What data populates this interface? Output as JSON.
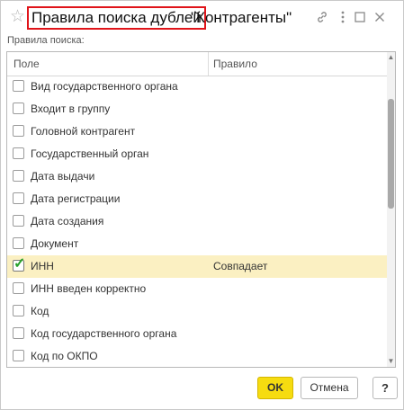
{
  "window": {
    "title_highlight": "Правила поиска дублей",
    "title_rest": "\"Контрагенты\""
  },
  "icons": {
    "favorite": "star-icon",
    "link": "link-icon",
    "more": "more-vertical-icon",
    "maximize": "maximize-icon",
    "close": "close-icon"
  },
  "search": {
    "label": "Правила поиска:"
  },
  "grid": {
    "headers": {
      "field": "Поле",
      "rule": "Правило"
    },
    "rows": [
      {
        "field": "Вид государственного органа",
        "rule": "",
        "checked": false
      },
      {
        "field": "Входит в группу",
        "rule": "",
        "checked": false
      },
      {
        "field": "Головной контрагент",
        "rule": "",
        "checked": false
      },
      {
        "field": "Государственный орган",
        "rule": "",
        "checked": false
      },
      {
        "field": "Дата выдачи",
        "rule": "",
        "checked": false
      },
      {
        "field": "Дата регистрации",
        "rule": "",
        "checked": false
      },
      {
        "field": "Дата создания",
        "rule": "",
        "checked": false
      },
      {
        "field": "Документ",
        "rule": "",
        "checked": false
      },
      {
        "field": "ИНН",
        "rule": "Совпадает",
        "checked": true
      },
      {
        "field": "ИНН введен корректно",
        "rule": "",
        "checked": false
      },
      {
        "field": "Код",
        "rule": "",
        "checked": false
      },
      {
        "field": "Код государственного органа",
        "rule": "",
        "checked": false
      },
      {
        "field": "Код по ОКПО",
        "rule": "",
        "checked": false
      }
    ]
  },
  "buttons": {
    "ok": "OK",
    "cancel": "Отмена",
    "help": "?"
  },
  "colors": {
    "accent": "#f6dc10",
    "selected_row": "#fbf0c2",
    "highlight_border": "#e0141a",
    "check": "#27a12a"
  }
}
